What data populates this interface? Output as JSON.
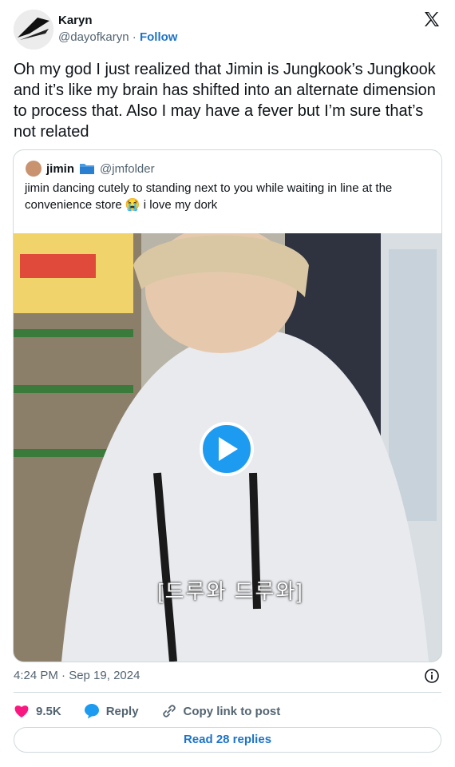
{
  "tweet": {
    "author_name": "Karyn",
    "author_handle": "@dayofkaryn",
    "separator": "·",
    "follow_label": "Follow",
    "text": "Oh my god I just realized that Jimin is Jungkook’s Jungkook and it’s like my brain has shifted into an alternate dimension to process that. Also I may have a fever but I’m sure that’s not related",
    "time": "4:24 PM · Sep 19, 2024"
  },
  "quote": {
    "author_name": "jimin",
    "author_handle": "@jmfolder",
    "text": "jimin dancing cutely to standing next to you while waiting in line at the convenience store 😭 i love my dork",
    "video_subtitle": "[드루와 드루와]"
  },
  "actions": {
    "likes": "9.5K",
    "reply_label": "Reply",
    "copy_label": "Copy link to post",
    "read_replies_label": "Read 28 replies"
  },
  "colors": {
    "accent": "#1d9bf0",
    "link": "#1d74c7",
    "like": "#f91880"
  }
}
